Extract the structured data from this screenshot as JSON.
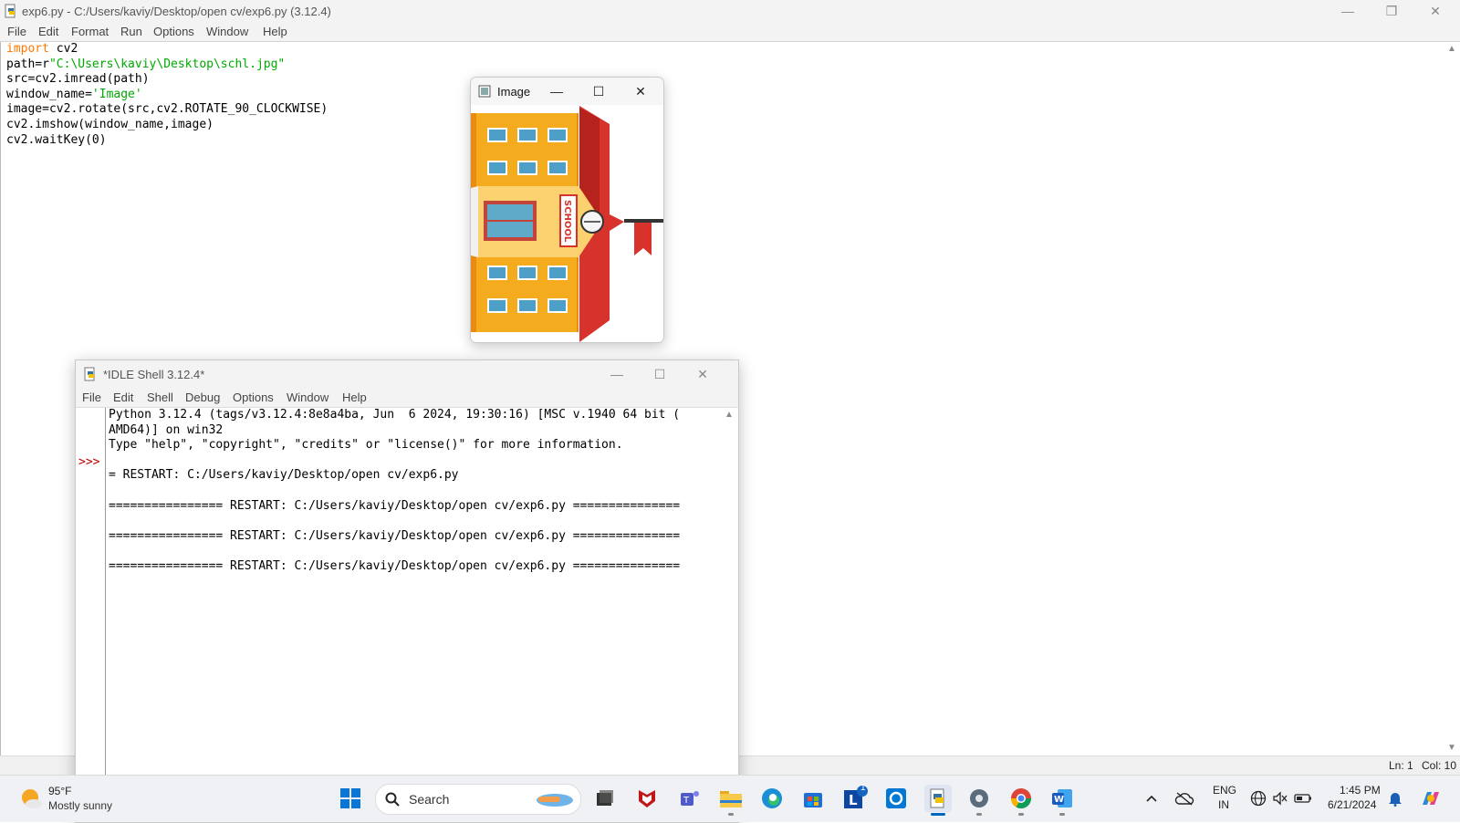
{
  "editor": {
    "title": "exp6.py - C:/Users/kaviy/Desktop/open cv/exp6.py (3.12.4)",
    "menu": [
      "File",
      "Edit",
      "Format",
      "Run",
      "Options",
      "Window",
      "Help"
    ],
    "code": [
      {
        "parts": [
          {
            "t": "import",
            "c": "kw"
          },
          {
            "t": " cv2",
            "c": ""
          }
        ]
      },
      {
        "parts": [
          {
            "t": "path=r",
            "c": ""
          },
          {
            "t": "\"C:\\Users\\kaviy\\Desktop\\schl.jpg\"",
            "c": "str"
          }
        ]
      },
      {
        "parts": [
          {
            "t": "src=cv2.imread(path)",
            "c": ""
          }
        ]
      },
      {
        "parts": [
          {
            "t": "window_name=",
            "c": ""
          },
          {
            "t": "'Image'",
            "c": "str"
          }
        ]
      },
      {
        "parts": [
          {
            "t": "image=cv2.rotate(src,cv2.ROTATE_90_CLOCKWISE)",
            "c": ""
          }
        ]
      },
      {
        "parts": [
          {
            "t": "cv2.imshow(window_name,image)",
            "c": ""
          }
        ]
      },
      {
        "parts": [
          {
            "t": "cv2.waitKey(0)",
            "c": ""
          }
        ]
      }
    ],
    "status_ln": "Ln: 1",
    "status_col": "Col: 10"
  },
  "image_window": {
    "title": "Image",
    "sign_text": "SCHOOL"
  },
  "shell": {
    "title": "*IDLE Shell 3.12.4*",
    "menu": [
      "File",
      "Edit",
      "Shell",
      "Debug",
      "Options",
      "Window",
      "Help"
    ],
    "prompt": ">>>",
    "lines": [
      "Python 3.12.4 (tags/v3.12.4:8e8a4ba, Jun  6 2024, 19:30:16) [MSC v.1940 64 bit (",
      "AMD64)] on win32",
      "Type \"help\", \"copyright\", \"credits\" or \"license()\" for more information.",
      "",
      "= RESTART: C:/Users/kaviy/Desktop/open cv/exp6.py",
      "",
      "================ RESTART: C:/Users/kaviy/Desktop/open cv/exp6.py ===============",
      "",
      "================ RESTART: C:/Users/kaviy/Desktop/open cv/exp6.py ===============",
      "",
      "================ RESTART: C:/Users/kaviy/Desktop/open cv/exp6.py ==============="
    ]
  },
  "taskbar": {
    "weather_temp": "95°F",
    "weather_desc": "Mostly sunny",
    "search_label": "Search",
    "lang_line1": "ENG",
    "lang_line2": "IN",
    "time": "1:45 PM",
    "date": "6/21/2024",
    "badge_count": "1",
    "apps": [
      "start-icon",
      "search-icon",
      "file-manager-icon",
      "mcafee-icon",
      "teams-icon",
      "file-explorer-icon",
      "edge-icon",
      "store-icon",
      "l-app-icon",
      "cortana-icon",
      "python-idle-icon",
      "settings-icon",
      "chrome-icon",
      "word-icon"
    ]
  },
  "colors": {
    "keyword": "#ff7700",
    "string": "#00aa00",
    "prompt": "#c00000",
    "taskbar_active": "#0067c0"
  }
}
